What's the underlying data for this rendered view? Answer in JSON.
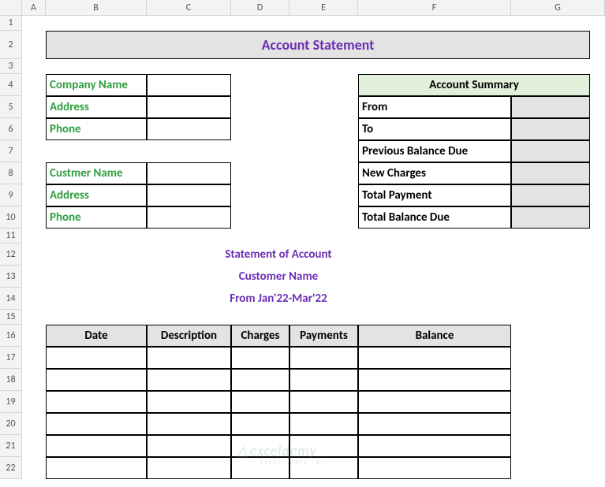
{
  "columns": [
    "A",
    "B",
    "C",
    "D",
    "E",
    "F",
    "G"
  ],
  "rows": [
    "1",
    "2",
    "3",
    "4",
    "5",
    "6",
    "7",
    "8",
    "9",
    "10",
    "11",
    "12",
    "13",
    "14",
    "15",
    "16",
    "17",
    "18",
    "19",
    "20",
    "21",
    "22"
  ],
  "title": "Account Statement",
  "company": {
    "name_label": "Company Name",
    "address_label": "Address",
    "phone_label": "Phone"
  },
  "customer": {
    "name_label": "Custmer Name",
    "address_label": "Address",
    "phone_label": "Phone"
  },
  "summary": {
    "header": "Account Summary",
    "rows": [
      "From",
      "To",
      "Previous Balance Due",
      "New Charges",
      "Total Payment",
      "Total Balance Due"
    ]
  },
  "mid": {
    "line1": "Statement of Account",
    "line2": "Customer Name",
    "line3": "From Jan'22-Mar'22"
  },
  "table_headers": [
    "Date",
    "Description",
    "Charges",
    "Payments",
    "Balance"
  ],
  "watermark": "exceldemy",
  "watermark_sub": "EXCEL · DATA · BI"
}
